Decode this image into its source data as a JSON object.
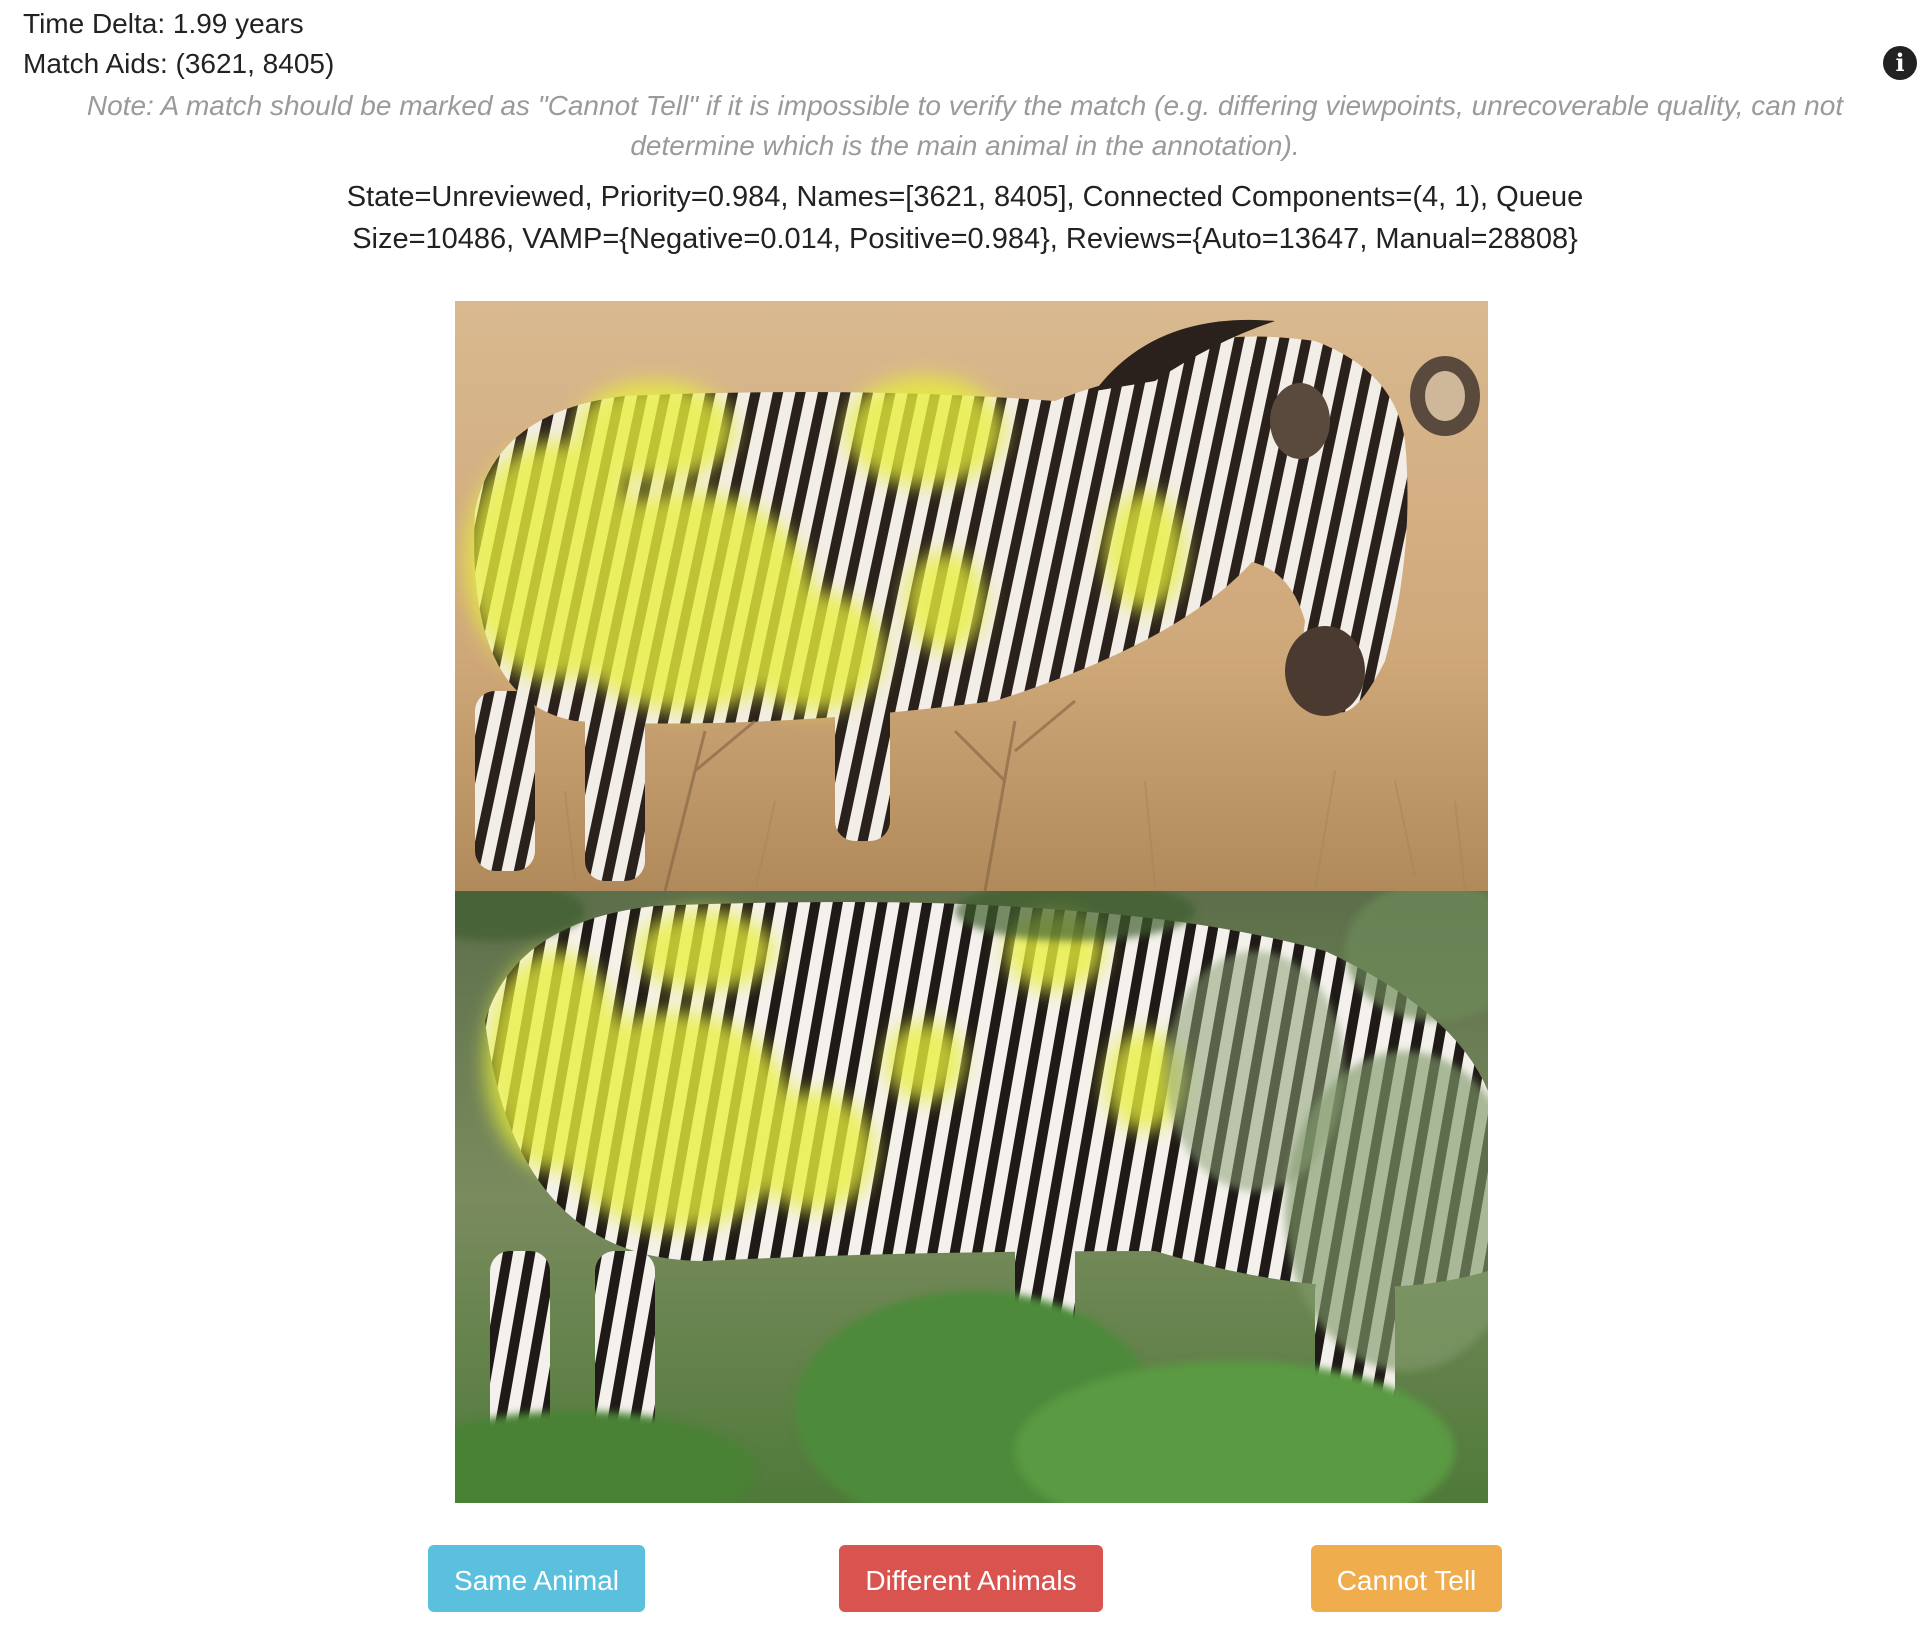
{
  "header": {
    "time_delta": "Time Delta: 1.99 years",
    "match_aids": "Match Aids: (3621, 8405)",
    "info_icon": "info-circle-icon"
  },
  "note": "Note: A match should be marked as \"Cannot Tell\" if it is impossible to verify the match (e.g. differing viewpoints, unrecoverable quality, can not determine which is the main animal in the annotation).",
  "status": "State=Unreviewed, Priority=0.984, Names=[3621, 8405], Connected Components=(4, 1), Queue Size=10486, VAMP={Negative=0.014, Positive=0.984}, Reviews={Auto=13647, Manual=28808}",
  "buttons": {
    "same": {
      "label": "Same Animal",
      "color": "#5bc0de"
    },
    "different": {
      "label": "Different Animals",
      "color": "#d9534f"
    },
    "cannot_tell": {
      "label": "Cannot Tell",
      "color": "#f0ad4e"
    }
  },
  "colors": {
    "highlight": "#e8f03a",
    "highlight_edge": "#c78fd0"
  }
}
